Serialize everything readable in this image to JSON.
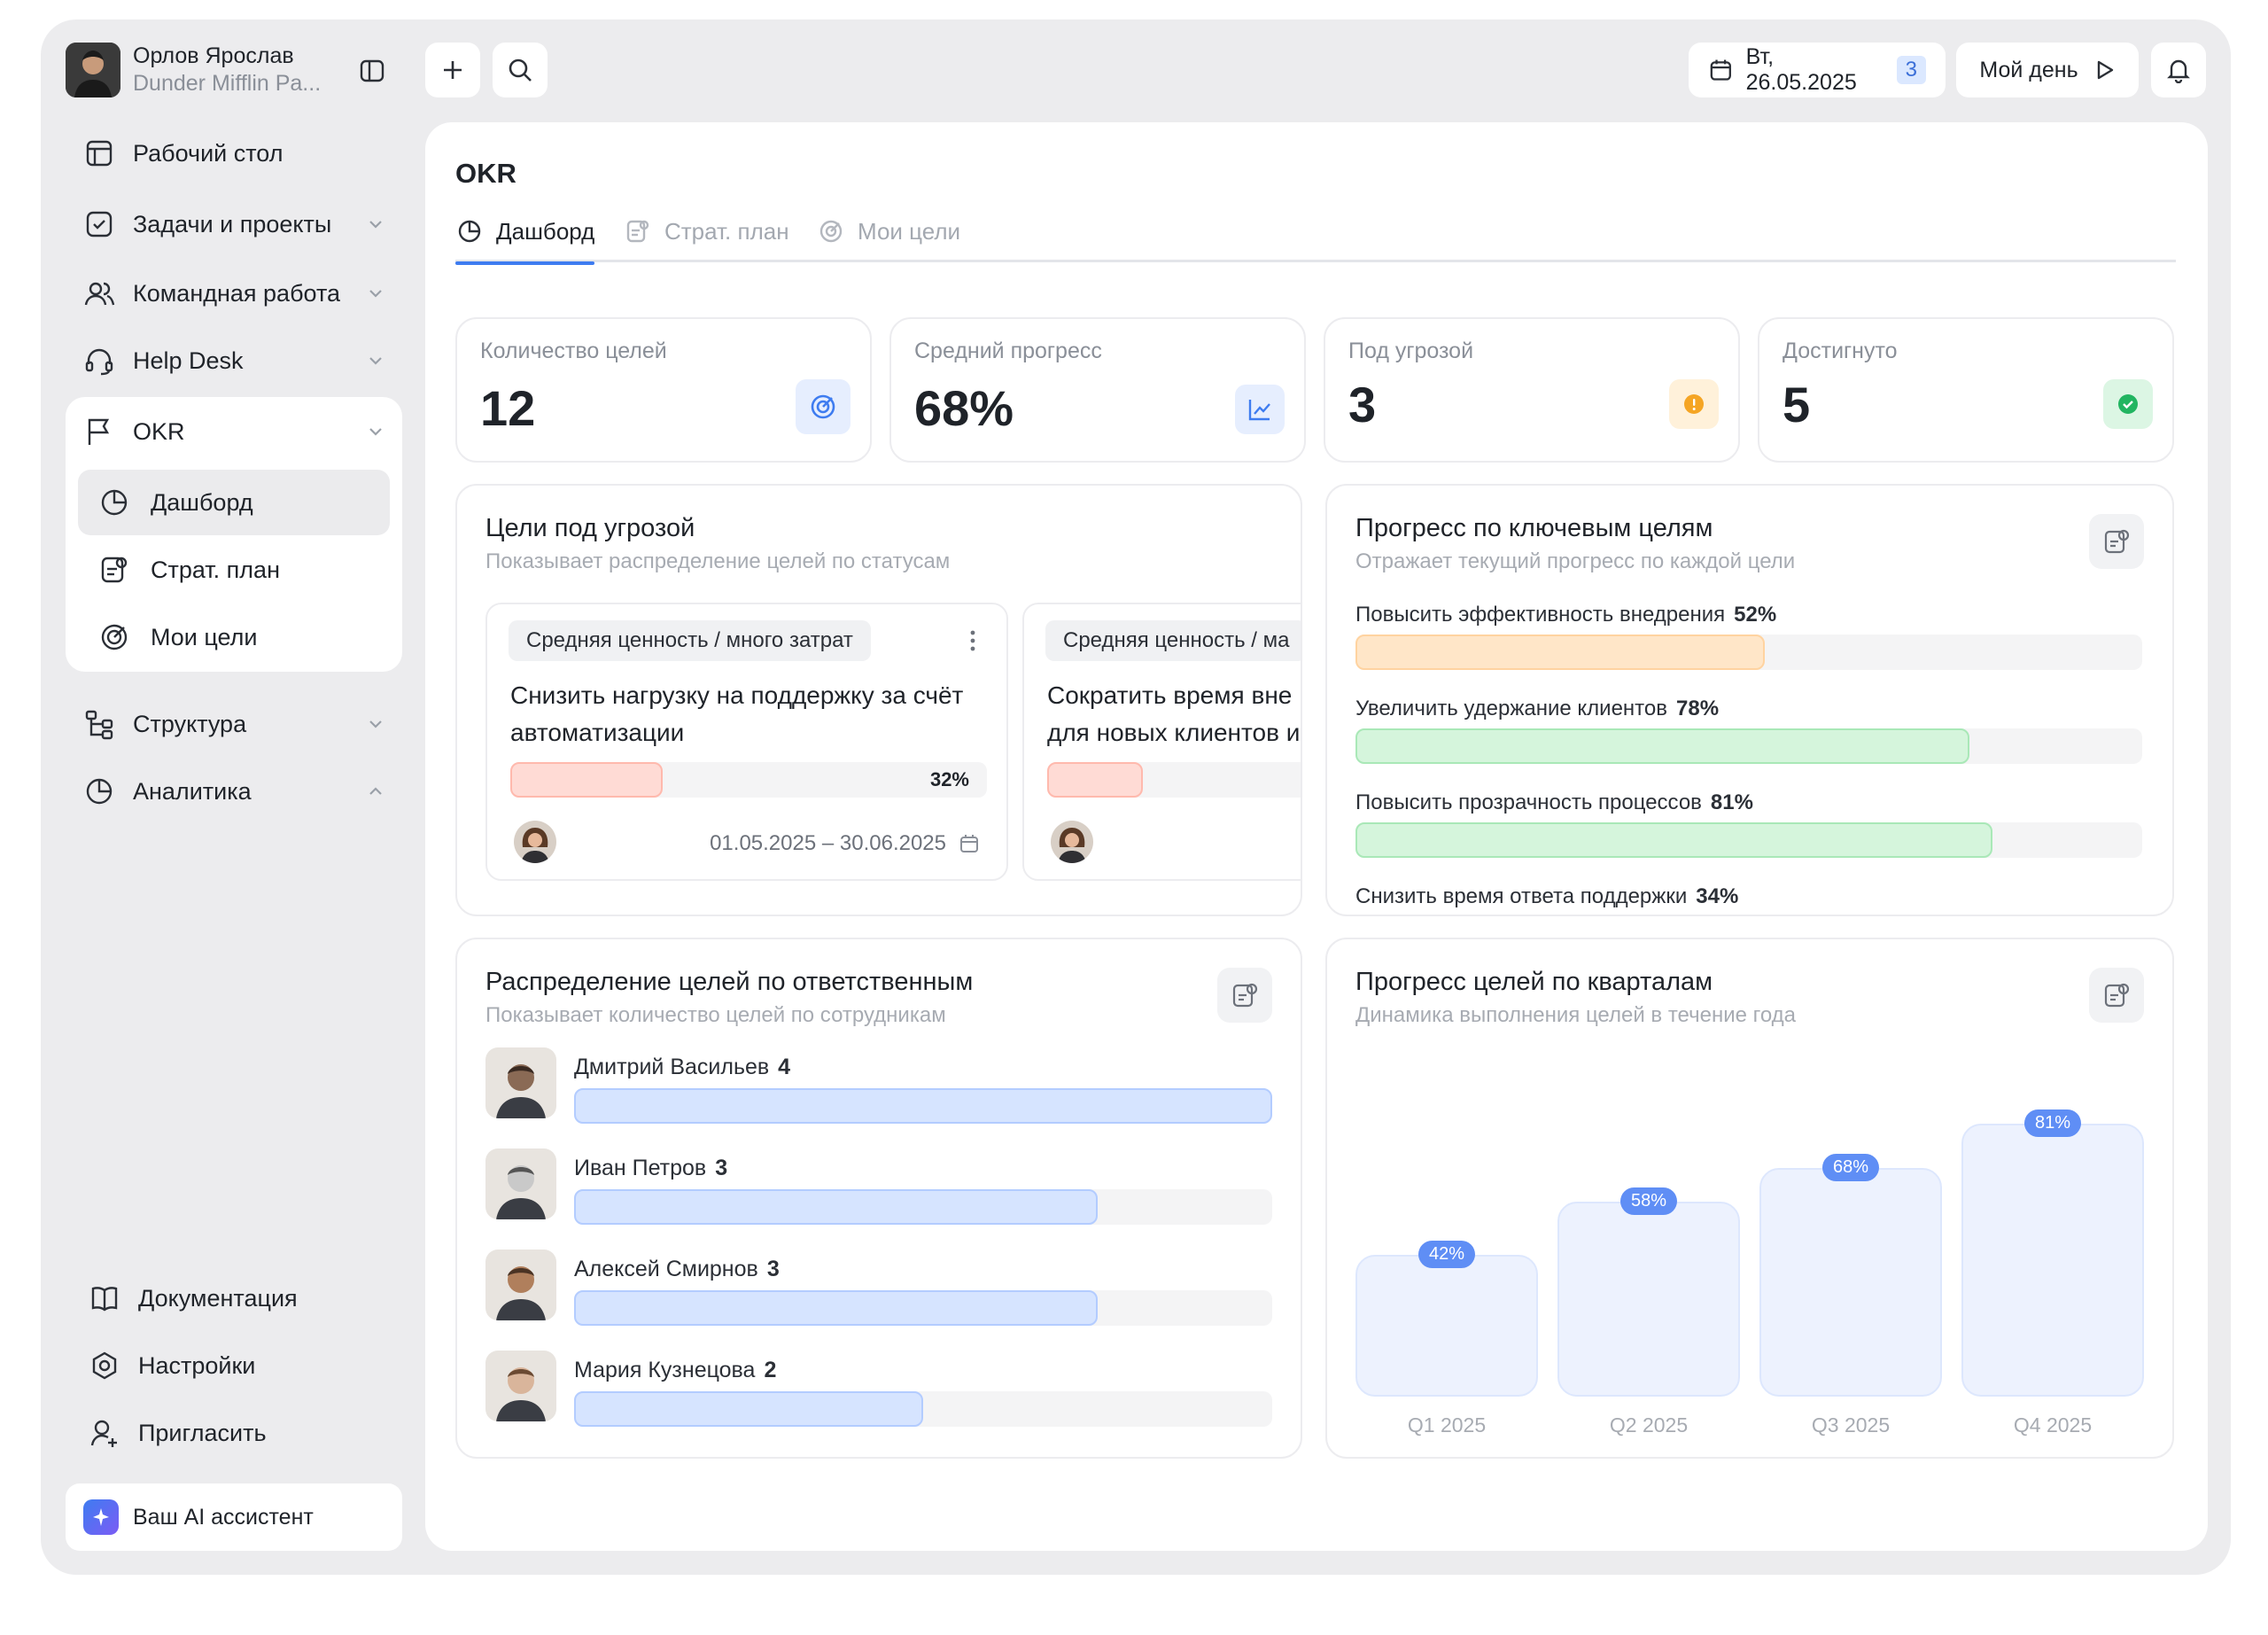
{
  "user": {
    "name": "Орлов Ярослав",
    "company": "Dunder Mifflin Pa..."
  },
  "topbar": {
    "date": "Вт, 26.05.2025",
    "date_count": "3",
    "my_day": "Мой день"
  },
  "sidebar": {
    "items": [
      {
        "label": "Рабочий стол",
        "icon": "desktop-icon"
      },
      {
        "label": "Задачи и проекты",
        "icon": "task-check-icon"
      },
      {
        "label": "Командная работа",
        "icon": "team-icon"
      },
      {
        "label": "Help Desk",
        "icon": "headset-icon"
      },
      {
        "label": "OKR",
        "icon": "flag-icon"
      },
      {
        "label": "Структура",
        "icon": "structure-icon"
      },
      {
        "label": "Аналитика",
        "icon": "pie-chart-icon"
      }
    ],
    "okr_sub": [
      {
        "label": "Дашборд",
        "icon": "pie-chart-icon"
      },
      {
        "label": "Страт. план",
        "icon": "plan-icon"
      },
      {
        "label": "Мои цели",
        "icon": "target-icon"
      }
    ],
    "bottom": [
      {
        "label": "Документация",
        "icon": "book-icon"
      },
      {
        "label": "Настройки",
        "icon": "settings-icon"
      },
      {
        "label": "Пригласить",
        "icon": "add-user-icon"
      }
    ],
    "ai": "Ваш AI ассистент"
  },
  "page": {
    "title": "OKR"
  },
  "tabs": [
    {
      "label": "Дашборд",
      "active": true
    },
    {
      "label": "Страт. план",
      "active": false
    },
    {
      "label": "Мои цели",
      "active": false
    }
  ],
  "stats": [
    {
      "label": "Количество целей",
      "value": "12",
      "icon": "target-icon",
      "color": "#3e7cf0"
    },
    {
      "label": "Средний прогресс",
      "value": "68%",
      "icon": "trend-icon",
      "color": "#3e7cf0"
    },
    {
      "label": "Под угрозой",
      "value": "3",
      "icon": "warning-icon",
      "color": "#f5a524"
    },
    {
      "label": "Достигнуто",
      "value": "5",
      "icon": "check-icon",
      "color": "#22b561"
    }
  ],
  "risk": {
    "title": "Цели под угрозой",
    "subtitle": "Показывает распределение целей по статусам",
    "cards": [
      {
        "tag": "Средняя ценность / много затрат",
        "title": "Снизить нагрузку на поддержку за счёт автоматизации",
        "progress": 32,
        "progress_label": "32%",
        "dates": "01.05.2025 – 30.06.2025"
      },
      {
        "tag": "Средняя ценность / ма",
        "title": "Сократить время вне для новых клиентов и",
        "progress": 20,
        "progress_label": "",
        "dates": ""
      }
    ]
  },
  "key_progress": {
    "title": "Прогресс по ключевым целям",
    "subtitle": "Отражает текущий прогресс по каждой цели",
    "items": [
      {
        "label": "Повысить эффективность внедрения",
        "pct": "52%",
        "value": 52,
        "color": "#ffe6c8",
        "border": "#ffd3a0"
      },
      {
        "label": "Увеличить удержание клиентов",
        "pct": "78%",
        "value": 78,
        "color": "#d5f5dc",
        "border": "#a9e8b7"
      },
      {
        "label": "Повысить прозрачность процессов",
        "pct": "81%",
        "value": 81,
        "color": "#d5f5dc",
        "border": "#a9e8b7"
      },
      {
        "label": "Снизить время ответа поддержки",
        "pct": "34%",
        "value": 34,
        "color": "#ffdbd5",
        "border": "#ffb9ad"
      }
    ]
  },
  "owners": {
    "title": "Распределение целей по ответственным",
    "subtitle": "Показывает количество целей по сотрудникам",
    "max": 4,
    "items": [
      {
        "name": "Дмитрий Васильев",
        "count": "4",
        "value": 4
      },
      {
        "name": "Иван Петров",
        "count": "3",
        "value": 3
      },
      {
        "name": "Алексей Смирнов",
        "count": "3",
        "value": 3
      },
      {
        "name": "Мария Кузнецова",
        "count": "2",
        "value": 2
      }
    ]
  },
  "chart_data": {
    "type": "bar",
    "title": "Прогресс целей по кварталам",
    "subtitle": "Динамика выполнения целей в течение года",
    "categories": [
      "Q1 2025",
      "Q2 2025",
      "Q3 2025",
      "Q4 2025"
    ],
    "values": [
      42,
      58,
      68,
      81
    ],
    "data_labels": [
      "42%",
      "58%",
      "68%",
      "81%"
    ],
    "ylim": [
      0,
      100
    ]
  }
}
